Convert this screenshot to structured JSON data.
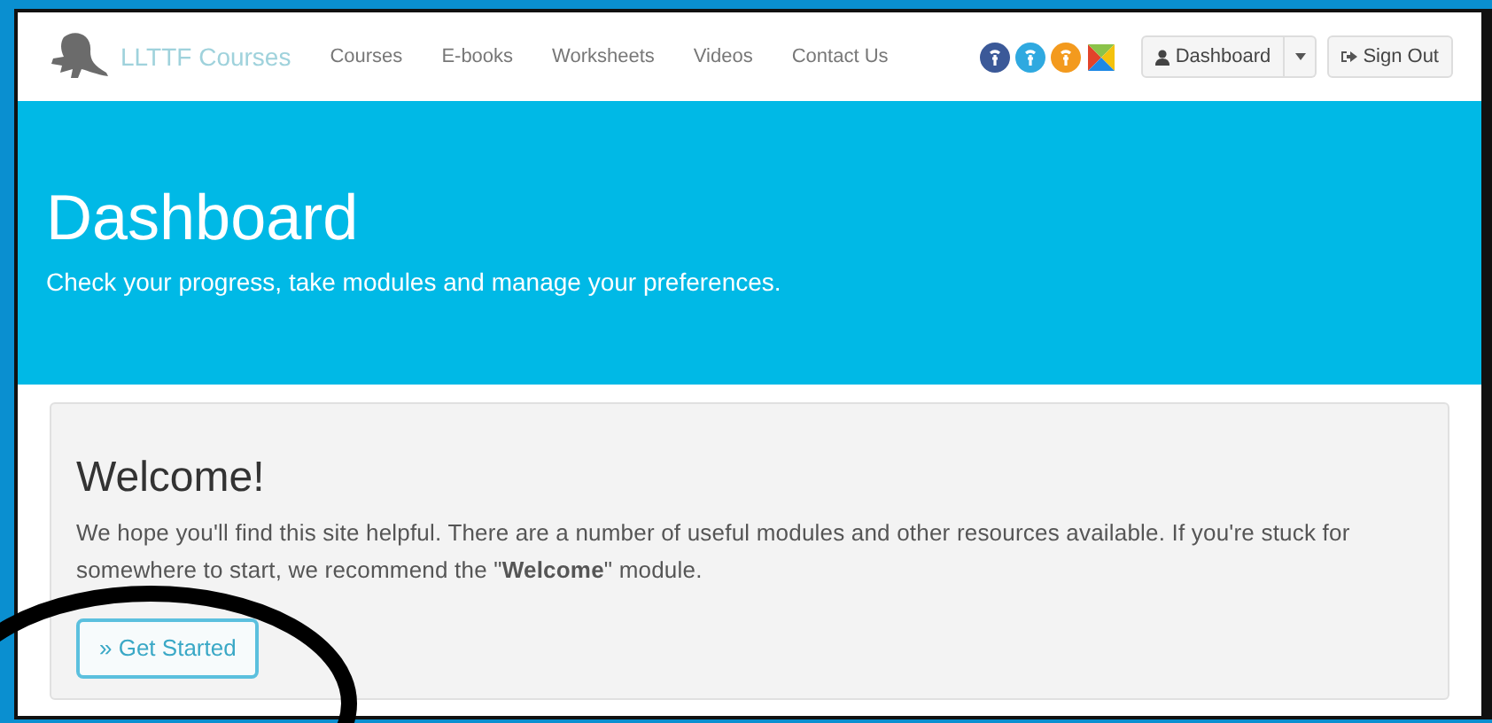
{
  "navbar": {
    "brand": "LLTTF Courses",
    "links": [
      "Courses",
      "E-books",
      "Worksheets",
      "Videos",
      "Contact Us"
    ],
    "social_icons": [
      {
        "color": "#3b5998"
      },
      {
        "color": "#2fa9e0"
      },
      {
        "color": "#f39a1e"
      },
      {
        "kind": "cross"
      }
    ],
    "dashboard_button": "Dashboard",
    "sign_out_button": "Sign Out"
  },
  "hero": {
    "title": "Dashboard",
    "subtitle": "Check your progress, take modules and manage your preferences."
  },
  "welcome": {
    "title": "Welcome!",
    "text": "We hope you'll find this site helpful. There are a number of useful modules and other resources available. If you're stuck for somewhere to start, we recommend the \"**Welcome**\" module.",
    "button": "» Get Started"
  }
}
